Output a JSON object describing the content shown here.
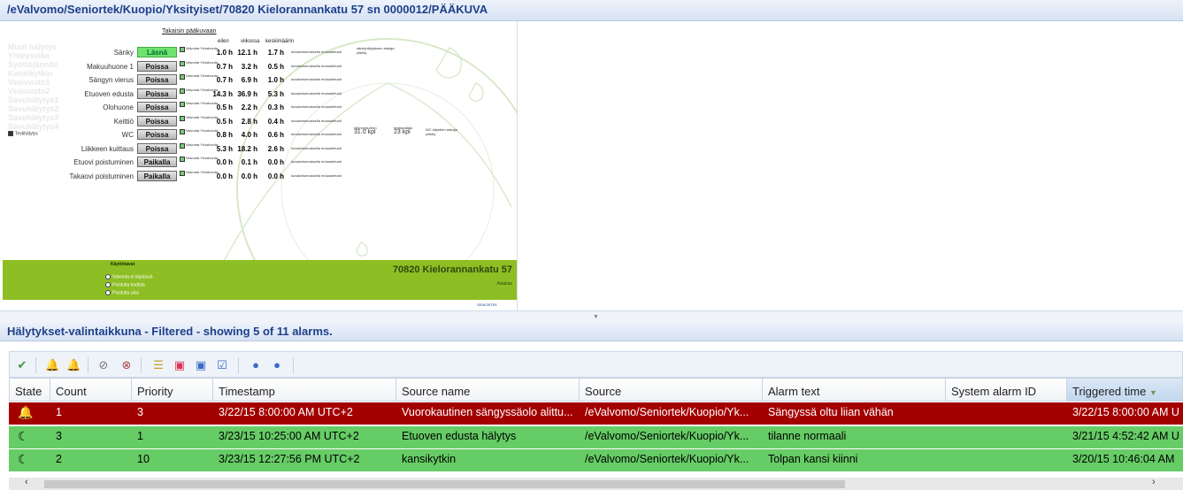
{
  "window": {
    "path": "/eValvomo/Seniortek/Kuopio/Yksityiset/70820 Kielorannankatu 57 sn 0000012/PÄÄKUVA"
  },
  "panel": {
    "back_link": "Takaisin pääkuvaan",
    "col_headers": [
      "eilen",
      "viikossa",
      "keskimäärin"
    ],
    "ghost_items": [
      "Muut hälytys",
      "Yhteysvika",
      "Syöttöjännite",
      "Kansikytkin",
      "Vesivuoto1",
      "Vesivuoto2",
      "Savuhälytys1",
      "Savuhälytys2",
      "Savuhälytys3",
      "Savuhälytys4"
    ],
    "reset_label": "Testihälytys",
    "valvonta_text": "Valvonta Yövalvonta",
    "link_text": "kuvaketunnuksella mukautetusti",
    "rooms": [
      {
        "name": "Sänky",
        "state": "Läsnä",
        "v1": "1.0 h",
        "v2": "12.1 h",
        "v3": "1.7 h",
        "green": true
      },
      {
        "name": "Makuuhuone 1",
        "state": "Poissa",
        "v1": "0.7 h",
        "v2": "3.2 h",
        "v3": "0.5 h",
        "green": false
      },
      {
        "name": "Sängyn vierus",
        "state": "Poissa",
        "v1": "0.7 h",
        "v2": "6.9 h",
        "v3": "1.0 h",
        "green": false
      },
      {
        "name": "Etuoven edusta",
        "state": "Poissa",
        "v1": "14.3 h",
        "v2": "36.9 h",
        "v3": "5.3 h",
        "green": false
      },
      {
        "name": "Olohuone",
        "state": "Poissa",
        "v1": "0.5 h",
        "v2": "2.2 h",
        "v3": "0.3 h",
        "green": false
      },
      {
        "name": "Keittiö",
        "state": "Poissa",
        "v1": "0.5 h",
        "v2": "2.8 h",
        "v3": "0.4 h",
        "green": false
      },
      {
        "name": "WC",
        "state": "Poissa",
        "v1": "0.8 h",
        "v2": "4.0 h",
        "v3": "0.6 h",
        "green": false
      },
      {
        "name": "Liikkeen kuittaus",
        "state": "Poissa",
        "v1": "5.3 h",
        "v2": "18.2 h",
        "v3": "2.6 h",
        "green": false
      },
      {
        "name": "Etuovi poistuminen",
        "state": "Paikalla",
        "v1": "0.0 h",
        "v2": "0.1 h",
        "v3": "0.0 h",
        "green": false
      },
      {
        "name": "Takaovi poistuminen",
        "state": "Paikalla",
        "v1": "0.0 h",
        "v2": "0.0 h",
        "v3": "0.0 h",
        "green": false
      }
    ],
    "note1": "sänkyhälytyksen alaraja",
    "note1b": "ylitetty",
    "wc_eilen_label": "käynnejä eilen",
    "wc_eilen_value": "31.0 kpl",
    "wc_avg_label": "keskimäärin",
    "wc_avg_value": "23 kpl",
    "wc_note": "WC käyntien alaraja",
    "wc_note_b": "ylitetty",
    "address": "70820 Kielorannankatu 57",
    "address_sub": "Asiakas",
    "mode_title": "Käyttötavat",
    "modes": [
      "Valvonta ei käytössä",
      "Poistuttu kodista",
      "Poistuttu ulos"
    ],
    "logo": "SENIORTEK"
  },
  "alarms": {
    "title": "Hälytykset-valintaikkuna - Filtered - showing 5 of 11 alarms.",
    "columns": [
      "State",
      "Count",
      "Priority",
      "Timestamp",
      "Source name",
      "Source",
      "Alarm text",
      "System alarm ID",
      "Triggered time"
    ],
    "rows": [
      {
        "count": "1",
        "priority": "3",
        "timestamp": "3/22/15 8:00:00 AM UTC+2",
        "source_name": "Vuorokautinen sängyssäolo alittu...",
        "source": "/eValvomo/Seniortek/Kuopio/Yk...",
        "alarm_text": "Sängyssä oltu liian vähän",
        "system_id": "",
        "triggered": "3/22/15 8:00:00 AM U",
        "style": "red",
        "icon": "bell-icon"
      },
      {
        "count": "3",
        "priority": "1",
        "timestamp": "3/23/15 10:25:00 AM UTC+2",
        "source_name": "Etuoven edusta hälytys",
        "source": "/eValvomo/Seniortek/Kuopio/Yk...",
        "alarm_text": "tilanne normaali",
        "system_id": "",
        "triggered": "3/21/15 4:52:42 AM U",
        "style": "green",
        "icon": "acknowledged-icon"
      },
      {
        "count": "2",
        "priority": "10",
        "timestamp": "3/23/15 12:27:56 PM UTC+2",
        "source_name": "kansikytkin",
        "source": "/eValvomo/Seniortek/Kuopio/Yk...",
        "alarm_text": "Tolpan kansi kiinni",
        "system_id": "",
        "triggered": "3/20/15 10:46:04 AM",
        "style": "green",
        "icon": "acknowledged-icon"
      }
    ]
  },
  "toolbar_icons": [
    "check-icon",
    "bell-acknowledge-icon",
    "bell-icon",
    "filter-icon",
    "filter-clear-icon",
    "list-icon",
    "history-icon",
    "info-icon",
    "checklist-icon",
    "user-icon",
    "user-settings-icon"
  ],
  "colors": {
    "red_row": "#a30000",
    "green_row": "#66cc66",
    "title_blue": "#1e3f8a",
    "panel_green": "#8dbe23"
  }
}
